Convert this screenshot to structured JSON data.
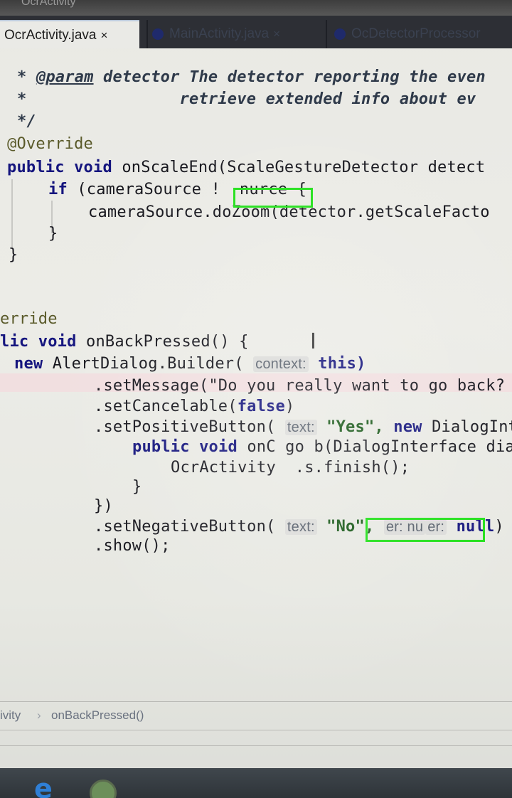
{
  "window": {
    "title": "OcrActivity"
  },
  "tabs": [
    {
      "label": "OcrActivity.java",
      "close": "×",
      "active": true
    },
    {
      "label": "MainActivity.java",
      "close": "×",
      "active": false
    },
    {
      "label": "OcDetectorProcessor",
      "active": false
    }
  ],
  "code": {
    "l1_tag": "@param",
    "l1_name": "detector",
    "l1_text": "The detector reporting the even",
    "l2_text": "retrieve extended info about ev",
    "l3": "*/",
    "l4": "@Override",
    "l5_kw": "public void",
    "l5_text": "onScaleEnd(ScaleGestureDetector detect",
    "l6_kw": "if",
    "l6_text": "(cameraSource !",
    "l6_b": "nurce",
    "l6_c": "{",
    "l7": "cameraSource.doZoom(detector.getScaleFacto",
    "l8": "}",
    "l9": "}",
    "l10": "erride",
    "l11_kw": "lic void",
    "l11_text": "onBackPressed() {",
    "l12_kw": "new",
    "l12_text": "AlertDialog.Builder(",
    "l12_hint": "context:",
    "l12_end": "this)",
    "l13": ".setMessage(\"Do you really want to go back?",
    "l14_a": ".setCancelable(",
    "l14_kw": "false",
    "l14_b": ")",
    "l15_a": ".setPositiveButton(",
    "l15_hint": "text:",
    "l15_str": "\"Yes\",",
    "l15_kw": "new",
    "l15_b": "DialogInt",
    "l16_kw": "public void",
    "l16_a": "onC",
    "l16_b": "go b",
    "l16_c": "(DialogInterface dial",
    "l17_a": "OcrActivity",
    "l17_b": ".s.finish();",
    "l18": "}",
    "l19": "})",
    "l20_a": ".setNegativeButton(",
    "l20_hint": "text:",
    "l20_str": "\"No\",",
    "l20_hint2": "er: nu",
    "l20_hint3": "er:",
    "l20_kw": "null",
    "l20_end": ")",
    "l21": ".show();"
  },
  "breadcrumb": {
    "left": "ivity",
    "separator": "›",
    "right": "onBackPressed()"
  },
  "colors": {
    "highlight_box": "#22e01a",
    "tab_bar": "#2d2f35",
    "keyword": "#15157e"
  },
  "icons": [
    "edge-icon",
    "chrome-icon",
    "text-cursor-icon",
    "close-icon"
  ]
}
